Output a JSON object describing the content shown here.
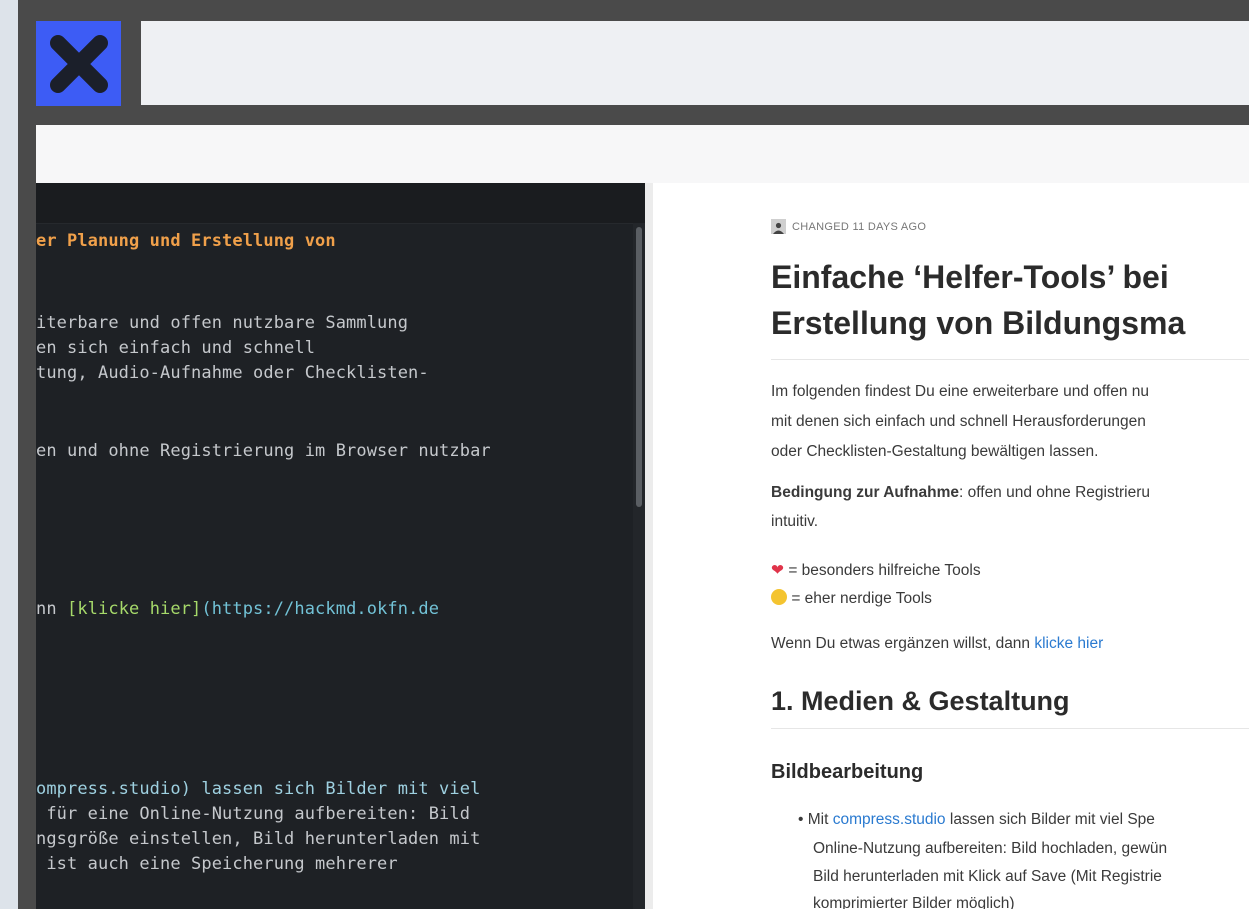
{
  "app": {
    "logo_icon": "x-icon",
    "accent": "#3d5cf5"
  },
  "editor": {
    "lines": [
      {
        "text": "er Planung und Erstellung von",
        "style": "heading"
      },
      {
        "text": "iterbare und offen nutzbare Sammlung"
      },
      {
        "text": "en sich einfach und schnell"
      },
      {
        "text": "tung, Audio-Aufnahme oder Checklisten-"
      },
      {
        "text": "en und ohne Registrierung im Browser nutzbar"
      },
      {
        "pre": "nn ",
        "link": "[klicke hier]",
        "url": "(https://hackmd.okfn.de"
      },
      {
        "text": "ompress.studio) lassen sich Bilder mit viel"
      },
      {
        "text": " für eine Online-Nutzung aufbereiten: Bild"
      },
      {
        "text": "ngsgröße einstellen, Bild herunterladen mit"
      },
      {
        "text": " ist auch eine Speicherung mehrerer"
      }
    ]
  },
  "preview": {
    "meta": "CHANGED 11 DAYS AGO",
    "title_line1": "Einfache ‘Helfer-Tools’ bei",
    "title_line2": "Erstellung von Bildungsma",
    "intro_lines": [
      "Im folgenden findest Du eine erweiterbare und offen nu",
      "mit denen sich einfach und schnell Herausforderungen",
      "oder Checklisten-Gestaltung bewältigen lassen."
    ],
    "condition_bold": "Bedingung zur Aufnahme",
    "condition_rest": ": offen und ohne Registrieru",
    "condition_line2": "intuitiv.",
    "legend_heart": "= besonders hilfreiche Tools",
    "legend_nerd": "= eher nerdige Tools",
    "contribute_text": "Wenn Du etwas ergänzen willst, dann ",
    "contribute_link": "klicke hier",
    "section_heading": "1. Medien & Gestaltung",
    "subsection_heading": "Bildbearbeitung",
    "bullet_pre": "Mit ",
    "bullet_link": "compress.studio",
    "bullet_rest": " lassen sich Bilder mit viel Spe",
    "bullet_line2": "Online-Nutzung aufbereiten: Bild hochladen, gewün",
    "bullet_line3": "Bild herunterladen mit Klick auf Save (Mit Registrie",
    "bullet_line4": "komprimierter Bilder möglich)"
  }
}
